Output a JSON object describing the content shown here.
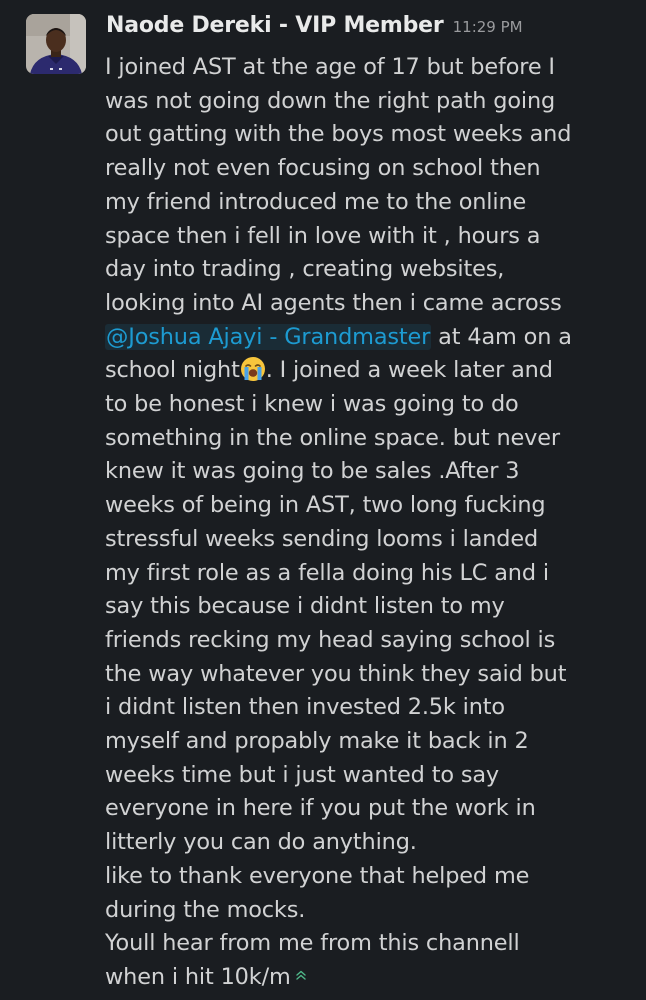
{
  "message": {
    "sender": "Naode Dereki - VIP Member",
    "timestamp": "11:29 PM",
    "lines_part1": [
      "I joined AST at the age of 17  but before I",
      "was not going down the right path going",
      "out gatting with the boys most weeks and",
      "really not even focusing on school then",
      "my friend introduced me to the online",
      "space then i fell in love with it , hours a",
      "day into trading , creating websites,",
      "looking into AI agents then i came across"
    ],
    "mention": "@Joshua Ajayi - Grandmaster",
    "mention_tail": " at 4am on a",
    "school_night": "school night",
    "after_emoji": ". I joined a week later and",
    "lines_part2": [
      "to be honest i knew i was going to do",
      "something in the online space. but never",
      "knew it was going to be sales .After 3",
      "weeks of being in AST, two long fucking",
      "stressful weeks sending looms i landed",
      "my first role as a fella doing his LC and i",
      "say this because i didnt listen to my",
      "friends recking my head saying school is",
      "the way whatever you think they said but",
      "i didnt listen then invested 2.5k into",
      "myself and propably make it back in 2",
      "weeks time but i just wanted to say",
      "everyone in here if you put the work in",
      "litterly you can do anything.",
      "like to thank everyone that helped me",
      "during the mocks.",
      "Youll hear from me from this channell"
    ],
    "last_line": "when i hit 10k/m",
    "emoji": "loudly-crying-face-icon",
    "trailing_icon": "double-chevron-up-icon",
    "colors": {
      "background": "#1a1d21",
      "text": "#d1d2d3",
      "mention": "#1d9bd1",
      "timestamp": "#9a9b9e"
    }
  }
}
